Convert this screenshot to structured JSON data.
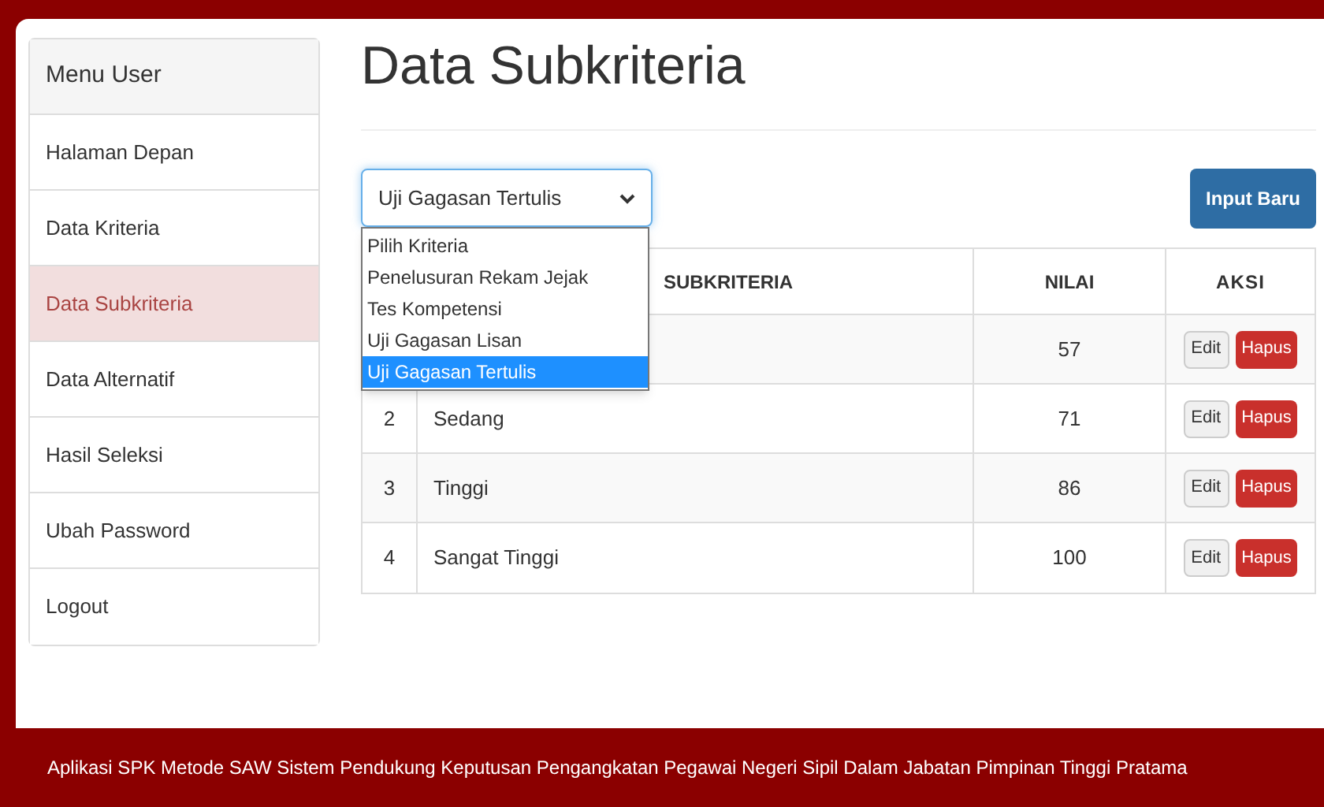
{
  "sidebar": {
    "title": "Menu User",
    "items": [
      {
        "label": "Halaman Depan",
        "selected": false
      },
      {
        "label": "Data Kriteria",
        "selected": false
      },
      {
        "label": "Data Subkriteria",
        "selected": true
      },
      {
        "label": "Data Alternatif",
        "selected": false
      },
      {
        "label": "Hasil Seleksi",
        "selected": false
      },
      {
        "label": "Ubah Password",
        "selected": false
      },
      {
        "label": "Logout",
        "selected": false
      }
    ]
  },
  "page_title": "Data Subkriteria",
  "select": {
    "value": "Uji Gagasan Tertulis",
    "expanded": true,
    "options": [
      {
        "label": "Pilih Kriteria",
        "selected": false
      },
      {
        "label": "Penelusuran Rekam Jejak",
        "selected": false
      },
      {
        "label": "Tes Kompetensi",
        "selected": false
      },
      {
        "label": "Uji Gagasan Lisan",
        "selected": false
      },
      {
        "label": "Uji Gagasan Tertulis",
        "selected": true
      }
    ]
  },
  "new_button": "Input Baru",
  "table": {
    "columns": [
      "SUBKRITERIA",
      "NILAI",
      "AKSI"
    ],
    "rows": [
      {
        "nilai": "57",
        "edit": "Edit",
        "delete": "Hapus"
      },
      {
        "no": "2",
        "name": "Sedang",
        "nilai": "71",
        "edit": "Edit",
        "delete": "Hapus"
      },
      {
        "no": "3",
        "name": "Tinggi",
        "nilai": "86",
        "edit": "Edit",
        "delete": "Hapus"
      },
      {
        "no": "4",
        "name": "Sangat Tinggi",
        "nilai": "100",
        "edit": "Edit",
        "delete": "Hapus"
      }
    ]
  },
  "footer": "Aplikasi SPK Metode SAW Sistem Pendukung Keputusan Pengangkatan Pegawai Negeri Sipil Dalam Jabatan Pimpinan Tinggi Pratama"
}
